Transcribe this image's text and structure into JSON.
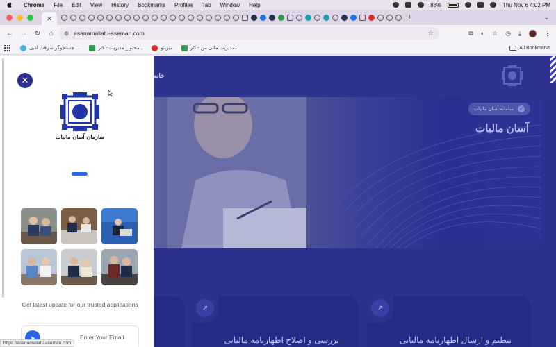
{
  "menubar": {
    "app_name": "Chrome",
    "items": [
      "File",
      "Edit",
      "View",
      "History",
      "Bookmarks",
      "Profiles",
      "Tab",
      "Window",
      "Help"
    ],
    "battery": "86%",
    "clock": "Thu Nov 6  4:02 PM"
  },
  "browser": {
    "url": "asanamaliat.i-aseman.com",
    "bookmarks": [
      {
        "label": "جستجوگر سرقت ادبی ...",
        "icon": "blue-circle-icon"
      },
      {
        "label": "محتوا_ مدیریت - کار...",
        "icon": "green-sheet-icon"
      },
      {
        "label": "میزینو",
        "icon": "red-logo-icon"
      },
      {
        "label": "مدیریت مالی من - کار...",
        "icon": "green-sheet-icon"
      }
    ],
    "all_bookmarks": "All Bookmarks",
    "status_url": "https://asanamaliat.i-aseman.com"
  },
  "site": {
    "nav_home": "خانه",
    "hero_pill": "سامانه آسان مالیات",
    "hero_title": "آسان مالیات",
    "cards": [
      {
        "title": "بررسی و اصلاح اظهارنامه مالیاتی"
      },
      {
        "title": "تنظیم و ارسال اظهارنامه مالیاتی"
      }
    ],
    "accent": "#2c318e"
  },
  "sidebar": {
    "close_icon": "close-icon",
    "logo_text": "سازمان آسان مالیات",
    "tagline": "Get latest update for our trusted applications",
    "email_placeholder": "Enter Your Email",
    "accent": "#2a62e8"
  }
}
